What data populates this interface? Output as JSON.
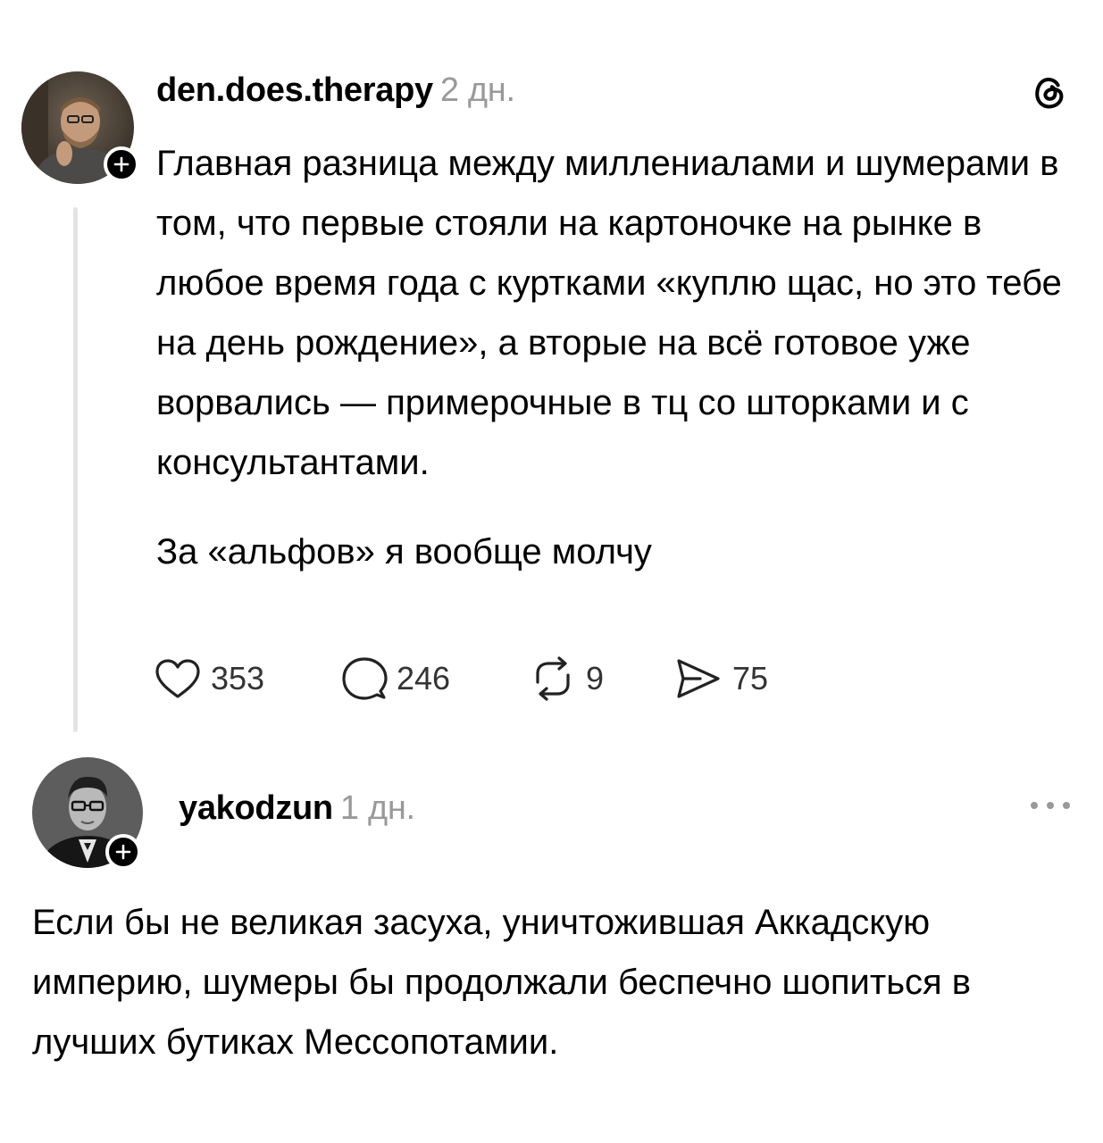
{
  "post": {
    "username": "den.does.therapy",
    "time": "2 дн.",
    "paragraphs": [
      "Главная разница между миллениалами и шумерами в том, что первые стояли на картоночке на рынке в любое время года с куртками «куплю щас, но это тебе на день рождение», а вторые на всё готовое уже ворвались — примерочные в тц со шторками и с консультантами.",
      "За «альфов» я вообще молчу"
    ],
    "stats": {
      "likes": "353",
      "replies": "246",
      "reposts": "9",
      "shares": "75"
    }
  },
  "reply": {
    "username": "yakodzun",
    "time": "1 дн.",
    "text": "Если бы не великая засуха, уничтожившая Аккадскую империю, шумеры бы продолжали беспечно шопиться в лучших бутиках Мессопотамии."
  },
  "icons": {
    "app_logo": "threads-logo-icon",
    "more": "more-dots-icon",
    "like": "heart-icon",
    "reply": "speech-bubble-icon",
    "repost": "repost-icon",
    "share": "send-icon",
    "follow": "plus-icon"
  }
}
